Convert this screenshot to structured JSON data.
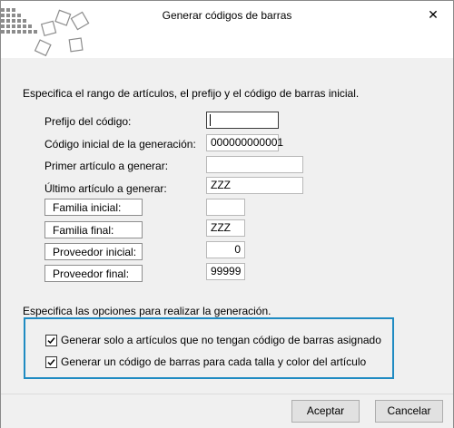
{
  "window": {
    "title": "Generar códigos de barras",
    "close_glyph": "✕"
  },
  "instruction": "Especifica el rango de artículos, el prefijo y el código de barras inicial.",
  "fields": {
    "prefijo": {
      "label": "Prefijo del código:",
      "value": ""
    },
    "codigo_inicial": {
      "label": "Código inicial de la generación:",
      "value": "000000000001"
    },
    "primer_articulo": {
      "label": "Primer artículo a generar:",
      "value": ""
    },
    "ultimo_articulo": {
      "label": "Último artículo a generar:",
      "value": "ZZZ"
    },
    "familia_inicial": {
      "label": "Familia inicial:",
      "value": ""
    },
    "familia_final": {
      "label": "Familia final:",
      "value": "ZZZ"
    },
    "proveedor_inicial": {
      "label": "Proveedor inicial:",
      "value": "0"
    },
    "proveedor_final": {
      "label": "Proveedor final:",
      "value": "99999"
    }
  },
  "options": {
    "title": "Especifica las opciones para realizar la generación.",
    "items": [
      {
        "label": "Generar solo a artículos que no tengan código de barras asignado",
        "checked": true
      },
      {
        "label": "Generar un código de barras para cada talla y color del artículo",
        "checked": true
      }
    ]
  },
  "buttons": {
    "accept": "Aceptar",
    "cancel": "Cancelar"
  },
  "colors": {
    "accent_border": "#1f8bc2",
    "logo_gray": "#8c8c8c"
  }
}
